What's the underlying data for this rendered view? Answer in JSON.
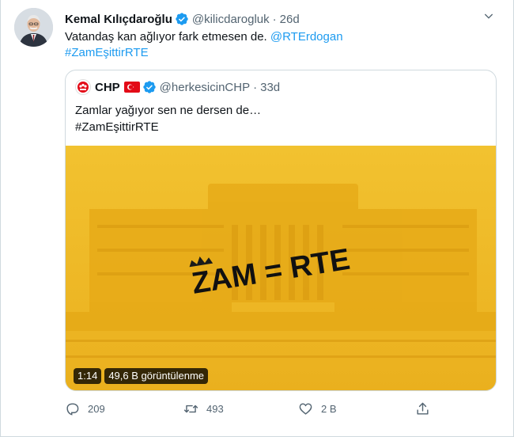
{
  "tweet": {
    "author_name": "Kemal Kılıçdaroğlu",
    "handle": "@kilicdarogluk",
    "separator": "·",
    "time": "26d",
    "text_plain": "Vatandaş kan ağlıyor fark etmesen de. ",
    "mention": "@RTErdogan",
    "hashtag": "#ZamEşittirRTE"
  },
  "quoted": {
    "author_name": "CHP",
    "handle": "@herkesicinCHP",
    "separator": "·",
    "time": "33d",
    "line1": "Zamlar yağıyor sen ne dersen de…",
    "line2": "#ZamEşittirRTE",
    "media": {
      "overlay_text": "ZAM = RTE",
      "duration": "1:14",
      "views": "49,6 B görüntülenme",
      "background_color": "#f0bb24"
    }
  },
  "actions": {
    "replies": "209",
    "retweets": "493",
    "likes": "2 B"
  },
  "colors": {
    "link": "#1d9bf0",
    "verified": "#1d9bf0",
    "muted": "#536471"
  }
}
